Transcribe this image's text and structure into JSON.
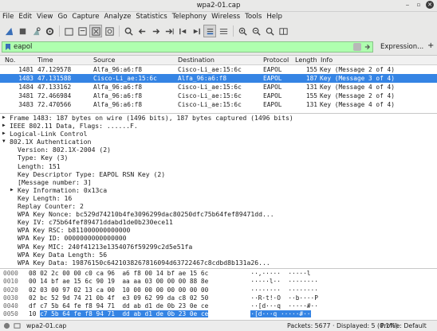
{
  "window": {
    "title": "wpa2-01.cap"
  },
  "menu": [
    "File",
    "Edit",
    "View",
    "Go",
    "Capture",
    "Analyze",
    "Statistics",
    "Telephony",
    "Wireless",
    "Tools",
    "Help"
  ],
  "toolbar_icons": [
    "shark-fin-start-icon",
    "stop-icon",
    "restart-icon",
    "options-gear-icon",
    "open-folder-icon",
    "save-icon",
    "close-file-icon",
    "reload-icon",
    "find-icon",
    "back-arrow-icon",
    "forward-arrow-icon",
    "go-to-packet-icon",
    "first-packet-icon",
    "last-packet-icon",
    "autoscroll-icon",
    "colorize-icon",
    "zoom-in-icon",
    "zoom-out-icon",
    "zoom-reset-icon",
    "resize-columns-icon"
  ],
  "filter": {
    "value": "eapol",
    "expression_label": "Expression...",
    "plus_label": "+"
  },
  "packet_list": {
    "columns": [
      "No.",
      "Time",
      "Source",
      "Destination",
      "Protocol",
      "Length",
      "Info"
    ],
    "rows": [
      {
        "no": "1481",
        "time": "47.129578",
        "source": "Alfa_96:a6:f8",
        "destination": "Cisco-Li_ae:15:6c",
        "protocol": "EAPOL",
        "length": "155",
        "info": "Key (Message 2 of 4)",
        "selected": false
      },
      {
        "no": "1483",
        "time": "47.131588",
        "source": "Cisco-Li_ae:15:6c",
        "destination": "Alfa_96:a6:f8",
        "protocol": "EAPOL",
        "length": "187",
        "info": "Key (Message 3 of 4)",
        "selected": true
      },
      {
        "no": "1484",
        "time": "47.133162",
        "source": "Alfa_96:a6:f8",
        "destination": "Cisco-Li_ae:15:6c",
        "protocol": "EAPOL",
        "length": "131",
        "info": "Key (Message 4 of 4)",
        "selected": false
      },
      {
        "no": "3481",
        "time": "72.466984",
        "source": "Alfa_96:a6:f8",
        "destination": "Cisco-Li_ae:15:6c",
        "protocol": "EAPOL",
        "length": "155",
        "info": "Key (Message 2 of 4)",
        "selected": false
      },
      {
        "no": "3483",
        "time": "72.470566",
        "source": "Alfa_96:a6:f8",
        "destination": "Cisco-Li_ae:15:6c",
        "protocol": "EAPOL",
        "length": "131",
        "info": "Key (Message 4 of 4)",
        "selected": false
      }
    ]
  },
  "details": [
    {
      "text": "Frame 1483: 187 bytes on wire (1496 bits), 187 bytes captured (1496 bits)",
      "level": 0,
      "arrow": "right"
    },
    {
      "text": "IEEE 802.11 Data, Flags: ......F.",
      "level": 0,
      "arrow": "right"
    },
    {
      "text": "Logical-Link Control",
      "level": 0,
      "arrow": "right"
    },
    {
      "text": "802.1X Authentication",
      "level": 0,
      "arrow": "down"
    },
    {
      "text": "Version: 802.1X-2004 (2)",
      "level": 1,
      "arrow": ""
    },
    {
      "text": "Type: Key (3)",
      "level": 1,
      "arrow": ""
    },
    {
      "text": "Length: 151",
      "level": 1,
      "arrow": ""
    },
    {
      "text": "Key Descriptor Type: EAPOL RSN Key (2)",
      "level": 1,
      "arrow": ""
    },
    {
      "text": "[Message number: 3]",
      "level": 1,
      "arrow": ""
    },
    {
      "text": "Key Information: 0x13ca",
      "level": 1,
      "arrow": "right"
    },
    {
      "text": "Key Length: 16",
      "level": 1,
      "arrow": ""
    },
    {
      "text": "Replay Counter: 2",
      "level": 1,
      "arrow": ""
    },
    {
      "text": "WPA Key Nonce: bc529d74210b4fe3096299dac80250dfc75b64fef89471dd...",
      "level": 1,
      "arrow": ""
    },
    {
      "text": "Key IV: c75b64fef89471ddabd1de0b230ece11",
      "level": 1,
      "arrow": ""
    },
    {
      "text": "WPA Key RSC: b811000000000000",
      "level": 1,
      "arrow": ""
    },
    {
      "text": "WPA Key ID: 0000000000000000",
      "level": 1,
      "arrow": ""
    },
    {
      "text": "WPA Key MIC: 240f41213e1354076f59299c2d5e51fa",
      "level": 1,
      "arrow": ""
    },
    {
      "text": "WPA Key Data Length: 56",
      "level": 1,
      "arrow": ""
    },
    {
      "text": "WPA Key Data: 19876150c6421038267816094d63722467c8cdbd8b131a26...",
      "level": 1,
      "arrow": ""
    }
  ],
  "bytes": [
    {
      "offset": "0000",
      "hex": "08 02 2c 00 00 c0 ca 96  a6 f8 00 14 bf ae 15 6c",
      "ascii": "  ··,·····  ·····l",
      "hl_hex": "",
      "hl_ascii": ""
    },
    {
      "offset": "0010",
      "hex": "00 14 bf ae 15 6c 90 19  aa aa 03 00 00 00 88 8e",
      "ascii": "  ·····l··  ········",
      "hl_hex": "",
      "hl_ascii": ""
    },
    {
      "offset": "0020",
      "hex": "02 03 00 97 02 13 ca 00  10 00 00 00 00 00 00 00",
      "ascii": "  ········  ········",
      "hl_hex": "",
      "hl_ascii": ""
    },
    {
      "offset": "0030",
      "hex": "02 bc 52 9d 74 21 0b 4f  e3 09 62 99 da c8 02 50",
      "ascii": "  ··R·t!·O  ··b····P",
      "hl_hex": "",
      "hl_ascii": ""
    },
    {
      "offset": "0040",
      "hex": "df c7 5b 64 fe f8 94 71  dd ab d1 de 0b 23 0e ce",
      "ascii": "  ··[d···q  ·····#··",
      "hl_hex": "",
      "hl_ascii": ""
    },
    {
      "offset": "0050",
      "hex": "10 ",
      "ascii": "  ",
      "hl_hex": "c7 5b 64 fe f8 94 71  dd ab d1 de 0b 23 0e ce",
      "hl_ascii": "·[d···q ·····#··"
    }
  ],
  "status": {
    "file_label": "wpa2-01.cap",
    "packets_text": "Packets: 5677 · Displayed: 5 (0.1%)",
    "profile_text": "Profile: Default"
  }
}
